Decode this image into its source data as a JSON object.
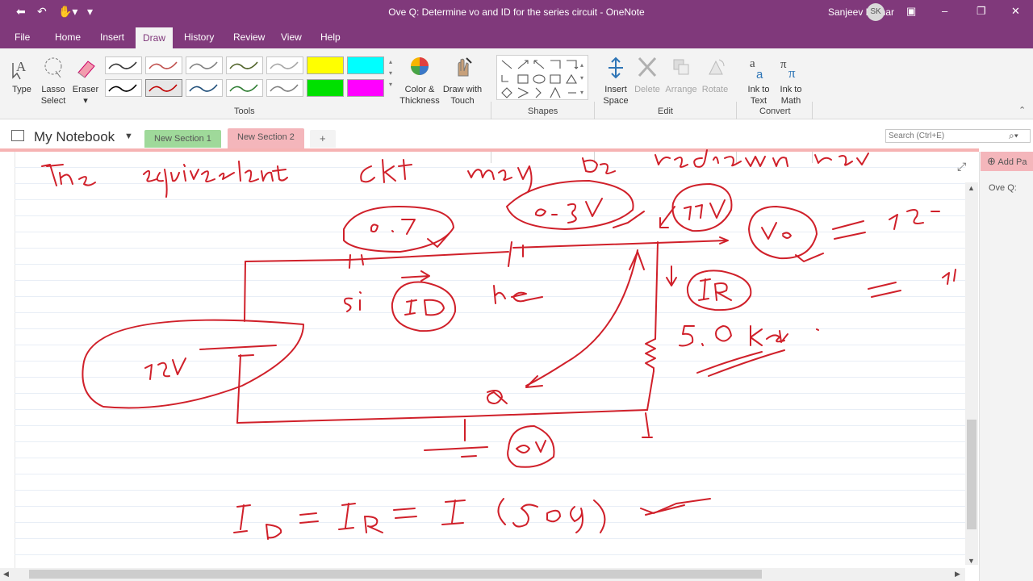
{
  "window": {
    "title": "Ove Q: Determine vo and ID for the series circuit  -  OneNote",
    "user": "Sanjeev Kumar",
    "avatar_initials": "SK"
  },
  "menu": [
    "File",
    "Home",
    "Insert",
    "Draw",
    "History",
    "Review",
    "View",
    "Help"
  ],
  "menu_active": "Draw",
  "ribbon": {
    "tools": {
      "type": "Type",
      "lasso_1": "Lasso",
      "lasso_2": "Select",
      "eraser": "Eraser",
      "color_1": "Color &",
      "color_2": "Thickness",
      "drawtouch_1": "Draw with",
      "drawtouch_2": "Touch",
      "group_label": "Tools"
    },
    "shapes_label": "Shapes",
    "edit": {
      "insert_1": "Insert",
      "insert_2": "Space",
      "delete": "Delete",
      "arrange": "Arrange",
      "rotate": "Rotate",
      "group_label": "Edit"
    },
    "convert": {
      "ink_text_1": "Ink to",
      "ink_text_2": "Text",
      "ink_math_1": "Ink to",
      "ink_math_2": "Math",
      "group_label": "Convert"
    },
    "pen_colors": [
      "#333333",
      "#c0504d",
      "#7f7f7f",
      "#4f6228",
      "#a6a6a6",
      "#ffff00",
      "#00ffff",
      "#000000",
      "#c00000",
      "#1f4e79",
      "#2e7d32",
      "#7f7f7f",
      "#00e000",
      "#ff00ff"
    ]
  },
  "nav": {
    "notebook": "My Notebook",
    "sections": [
      {
        "label": "New Section 1",
        "color": "#9fd99a"
      },
      {
        "label": "New Section 2",
        "color": "#f4b6bb"
      }
    ],
    "add_section": "+",
    "search_placeholder": "Search (Ctrl+E)"
  },
  "pages": {
    "add_page": "Add Pa",
    "items": [
      "Ove Q:"
    ]
  },
  "ink_color": "#d0202a"
}
